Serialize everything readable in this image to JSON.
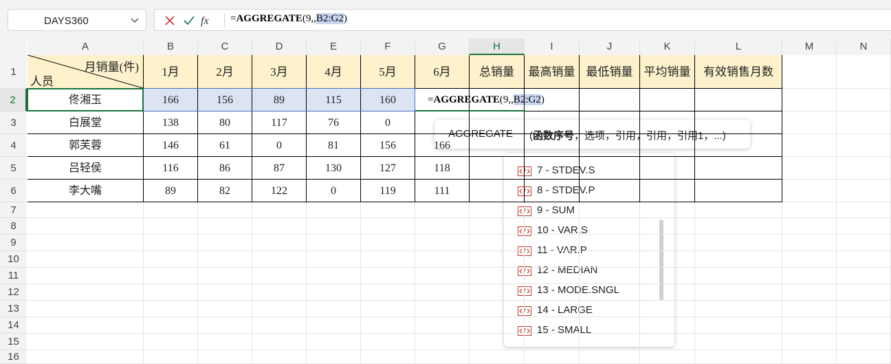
{
  "namebox": {
    "value": "DAYS360"
  },
  "formula_bar": {
    "eq": "=",
    "func": "AGGREGATE",
    "args": "(9,,",
    "ref": "B2:G2",
    "close": ")"
  },
  "columns": [
    "A",
    "B",
    "C",
    "D",
    "E",
    "F",
    "G",
    "H",
    "I",
    "J",
    "K",
    "L",
    "M",
    "N"
  ],
  "rows": [
    "1",
    "2",
    "3",
    "4",
    "5",
    "6",
    "7",
    "8",
    "9",
    "10",
    "11",
    "12",
    "13",
    "14",
    "15",
    "16"
  ],
  "header_row": {
    "diag_top": "月销量(件)",
    "diag_bottom": "人员",
    "months": [
      "1月",
      "2月",
      "3月",
      "4月",
      "5月",
      "6月"
    ],
    "extras": [
      "总销量",
      "最高销量",
      "最低销量",
      "平均销量",
      "有效销售月数"
    ]
  },
  "table": [
    {
      "name": "佟湘玉",
      "values": [
        "166",
        "156",
        "89",
        "115",
        "160"
      ]
    },
    {
      "name": "白展堂",
      "values": [
        "138",
        "80",
        "117",
        "76",
        "0"
      ]
    },
    {
      "name": "郭芙蓉",
      "values": [
        "146",
        "61",
        "0",
        "81",
        "156",
        "166"
      ]
    },
    {
      "name": "吕轻侯",
      "values": [
        "116",
        "86",
        "87",
        "130",
        "127",
        "118"
      ]
    },
    {
      "name": "李大嘴",
      "values": [
        "89",
        "82",
        "122",
        "0",
        "119",
        "111"
      ]
    }
  ],
  "cell_edit": {
    "eq": "=",
    "func": "AGGREGATE",
    "args": "(9,,",
    "ref": "B2:G2",
    "close": ")"
  },
  "tooltip": {
    "name": "AGGREGATE",
    "open": "(",
    "bold_arg": "函数序号",
    "rest": "，选项，引用，引用，引用1，...)"
  },
  "dropdown": [
    "7 - STDEV.S",
    "8 - STDEV.P",
    "9 - SUM",
    "10 - VAR.S",
    "11 - VAR.P",
    "12 - MEDIAN",
    "13 - MODE.SNGL",
    "14 - LARGE",
    "15 - SMALL"
  ],
  "colors": {
    "header_fill": "#fdf2cc",
    "selection_fill": "#dce3f3",
    "accent": "#16723b",
    "cancel": "#d13438"
  }
}
